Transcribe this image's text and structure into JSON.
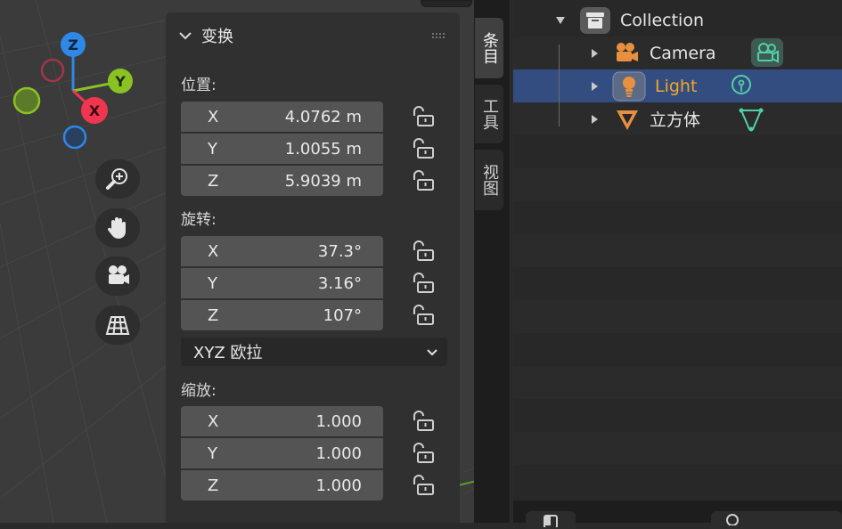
{
  "transform_panel": {
    "title": "变换",
    "location": {
      "label": "位置:",
      "fields": [
        {
          "axis": "X",
          "value": "4.0762 m"
        },
        {
          "axis": "Y",
          "value": "1.0055 m"
        },
        {
          "axis": "Z",
          "value": "5.9039 m"
        }
      ]
    },
    "rotation": {
      "label": "旋转:",
      "fields": [
        {
          "axis": "X",
          "value": "37.3°"
        },
        {
          "axis": "Y",
          "value": "3.16°"
        },
        {
          "axis": "Z",
          "value": "107°"
        }
      ],
      "mode": "XYZ 欧拉"
    },
    "scale": {
      "label": "缩放:",
      "fields": [
        {
          "axis": "X",
          "value": "1.000"
        },
        {
          "axis": "Y",
          "value": "1.000"
        },
        {
          "axis": "Z",
          "value": "1.000"
        }
      ]
    }
  },
  "side_tabs": [
    "条目",
    "工具",
    "视图"
  ],
  "gizmo": {
    "x": "X",
    "y": "Y",
    "z": "Z"
  },
  "outliner": {
    "collection": "Collection",
    "items": [
      {
        "label": "Camera",
        "icon": "camera-icon"
      },
      {
        "label": "Light",
        "icon": "light-icon",
        "selected": true
      },
      {
        "label": "立方体",
        "icon": "mesh-icon"
      }
    ]
  },
  "colors": {
    "axis_x": "#f0354f",
    "axis_y": "#8ac224",
    "axis_z": "#2f87e6",
    "selection": "#334d80",
    "light_label": "#f5a623",
    "data_icon": "#4fd1a5",
    "object_icon": "#e89040"
  }
}
